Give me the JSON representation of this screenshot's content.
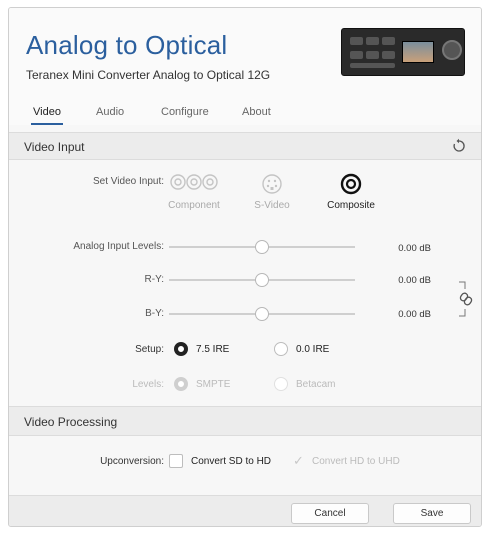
{
  "app": {
    "title": "Analog to Optical",
    "subtitle": "Teranex Mini Converter Analog to Optical 12G"
  },
  "tabs": [
    {
      "label": "Video",
      "active": true
    },
    {
      "label": "Audio",
      "active": false
    },
    {
      "label": "Configure",
      "active": false
    },
    {
      "label": "About",
      "active": false
    }
  ],
  "video_input": {
    "header": "Video Input",
    "set_input_label": "Set Video Input:",
    "options": [
      {
        "label": "Component",
        "selected": false,
        "icon": "component-connector-icon"
      },
      {
        "label": "S-Video",
        "selected": false,
        "icon": "svideo-connector-icon"
      },
      {
        "label": "Composite",
        "selected": true,
        "icon": "composite-connector-icon"
      }
    ],
    "levels": [
      {
        "label": "Analog Input Levels:",
        "value": "0.00 dB",
        "position": 0.5
      },
      {
        "label": "R-Y:",
        "value": "0.00 dB",
        "position": 0.5
      },
      {
        "label": "B-Y:",
        "value": "0.00 dB",
        "position": 0.5
      }
    ],
    "setup": {
      "label": "Setup:",
      "options": [
        {
          "label": "7.5 IRE",
          "selected": true
        },
        {
          "label": "0.0 IRE",
          "selected": false
        }
      ]
    },
    "levels_select": {
      "label": "Levels:",
      "options": [
        {
          "label": "SMPTE",
          "selected": true
        },
        {
          "label": "Betacam",
          "selected": false
        }
      ]
    }
  },
  "video_processing": {
    "header": "Video Processing",
    "upconversion_label": "Upconversion:",
    "options": [
      {
        "label": "Convert SD to HD",
        "checked": false
      },
      {
        "label": "Convert HD to UHD",
        "checked": true
      }
    ]
  },
  "footer": {
    "cancel_label": "Cancel",
    "save_label": "Save"
  }
}
